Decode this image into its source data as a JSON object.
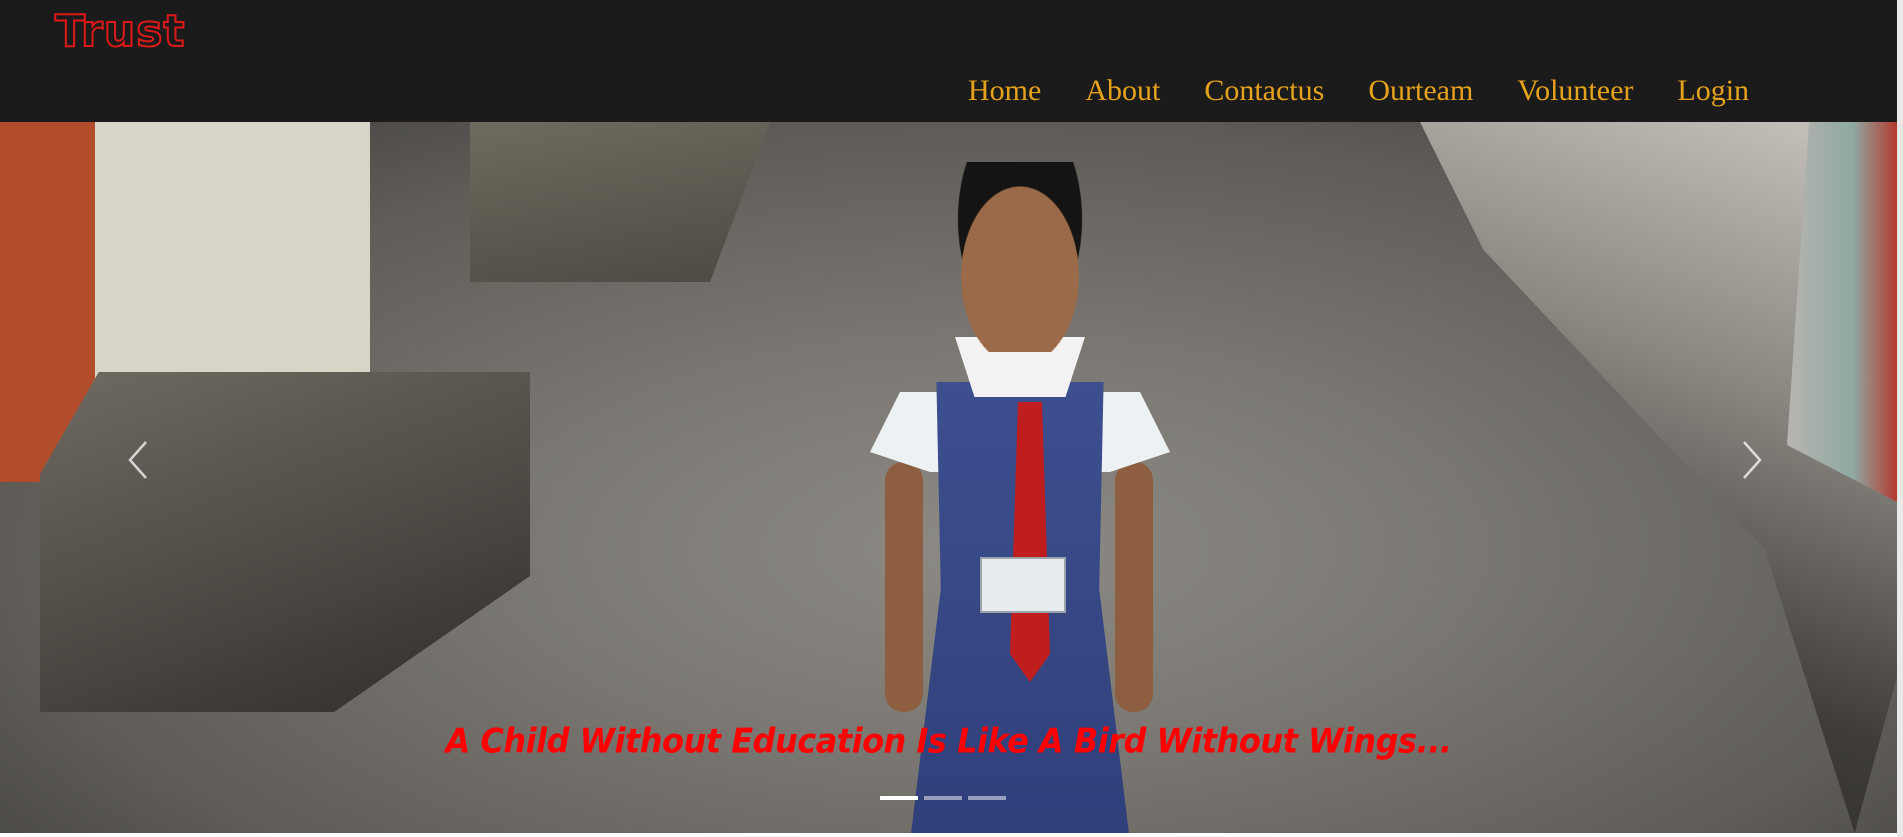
{
  "brand": {
    "name": "Trust"
  },
  "nav": {
    "items": [
      {
        "label": "Home"
      },
      {
        "label": "About"
      },
      {
        "label": "Contactus"
      },
      {
        "label": "Ourteam"
      },
      {
        "label": "Volunteer"
      },
      {
        "label": "Login"
      }
    ]
  },
  "carousel": {
    "caption": "A Child Without Education Is Like A Bird Without Wings...",
    "active_index": 0,
    "slide_count": 3,
    "prev_icon": "chevron-left-icon",
    "next_icon": "chevron-right-icon"
  },
  "colors": {
    "navbar_bg": "#1b1b1b",
    "nav_link": "#e6a21a",
    "brand": "#e01818",
    "caption": "#ff0000"
  }
}
